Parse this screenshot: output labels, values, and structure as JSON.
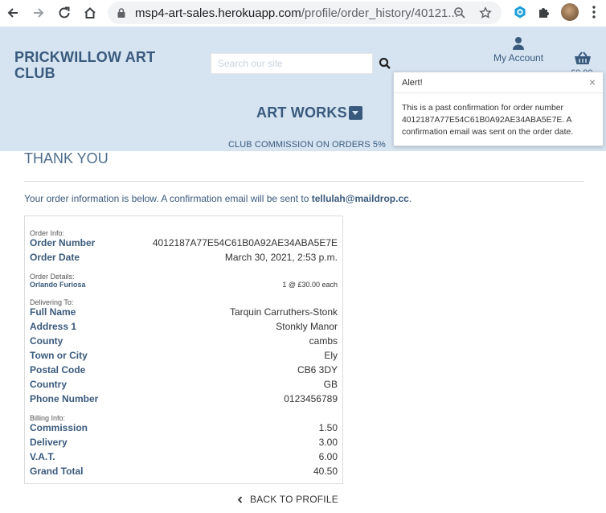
{
  "browser": {
    "url_domain": "msp4-art-sales.herokuapp.com",
    "url_path": "/profile/order_history/40121..."
  },
  "header": {
    "brand": "PRICKWILLOW ART CLUB",
    "search_placeholder": "Search our site",
    "account_label": "My Account",
    "basket_total": "£0.00",
    "nav_art_works": "ART WORKS",
    "banner": "CLUB COMMISSION ON ORDERS 5%"
  },
  "toast": {
    "title": "Alert!",
    "close": "×",
    "message": "This is a past confirmation for order number 4012187A77E54C61B0A92AE34ABA5E7E. A confirmation email was sent on the order date."
  },
  "main": {
    "title": "THANK YOU",
    "info_prefix": "Your order information is below. A confirmation email will be sent to ",
    "info_email": "tellulah@maildrop.cc",
    "info_suffix": ".",
    "sections": {
      "order_info": "Order Info:",
      "order_details": "Order Details:",
      "delivering_to": "Delivering To:",
      "billing_info": "Billing Info:"
    },
    "order_info": [
      {
        "label": "Order Number",
        "value": "4012187A77E54C61B0A92AE34ABA5E7E"
      },
      {
        "label": "Order Date",
        "value": "March 30, 2021, 2:53 p.m."
      }
    ],
    "order_items": [
      {
        "label": "Orlando Furiosa",
        "value": "1 @ £30.00 each"
      }
    ],
    "delivery": [
      {
        "label": "Full Name",
        "value": "Tarquin Carruthers-Stonk"
      },
      {
        "label": "Address 1",
        "value": "Stonkly Manor"
      },
      {
        "label": "County",
        "value": "cambs"
      },
      {
        "label": "Town or City",
        "value": "Ely"
      },
      {
        "label": "Postal Code",
        "value": "CB6 3DY"
      },
      {
        "label": "Country",
        "value": "GB"
      },
      {
        "label": "Phone Number",
        "value": "0123456789"
      }
    ],
    "billing": [
      {
        "label": "Commission",
        "value": "1.50"
      },
      {
        "label": "Delivery",
        "value": "3.00"
      },
      {
        "label": "V.A.T.",
        "value": "6.00"
      },
      {
        "label": "Grand Total",
        "value": "40.50"
      }
    ],
    "back_link": "BACK TO PROFILE"
  }
}
